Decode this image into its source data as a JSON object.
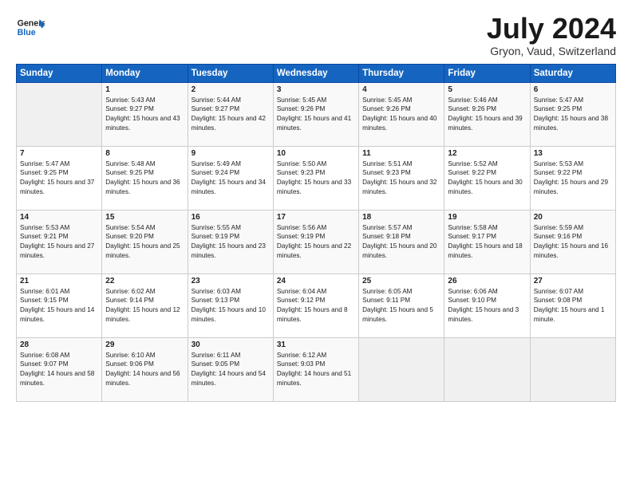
{
  "header": {
    "logo_line1": "General",
    "logo_line2": "Blue",
    "title": "July 2024",
    "subtitle": "Gryon, Vaud, Switzerland"
  },
  "weekdays": [
    "Sunday",
    "Monday",
    "Tuesday",
    "Wednesday",
    "Thursday",
    "Friday",
    "Saturday"
  ],
  "weeks": [
    [
      {
        "day": "",
        "empty": true
      },
      {
        "day": "1",
        "sunrise": "Sunrise: 5:43 AM",
        "sunset": "Sunset: 9:27 PM",
        "daylight": "Daylight: 15 hours and 43 minutes."
      },
      {
        "day": "2",
        "sunrise": "Sunrise: 5:44 AM",
        "sunset": "Sunset: 9:27 PM",
        "daylight": "Daylight: 15 hours and 42 minutes."
      },
      {
        "day": "3",
        "sunrise": "Sunrise: 5:45 AM",
        "sunset": "Sunset: 9:26 PM",
        "daylight": "Daylight: 15 hours and 41 minutes."
      },
      {
        "day": "4",
        "sunrise": "Sunrise: 5:45 AM",
        "sunset": "Sunset: 9:26 PM",
        "daylight": "Daylight: 15 hours and 40 minutes."
      },
      {
        "day": "5",
        "sunrise": "Sunrise: 5:46 AM",
        "sunset": "Sunset: 9:26 PM",
        "daylight": "Daylight: 15 hours and 39 minutes."
      },
      {
        "day": "6",
        "sunrise": "Sunrise: 5:47 AM",
        "sunset": "Sunset: 9:25 PM",
        "daylight": "Daylight: 15 hours and 38 minutes."
      }
    ],
    [
      {
        "day": "7",
        "sunrise": "Sunrise: 5:47 AM",
        "sunset": "Sunset: 9:25 PM",
        "daylight": "Daylight: 15 hours and 37 minutes."
      },
      {
        "day": "8",
        "sunrise": "Sunrise: 5:48 AM",
        "sunset": "Sunset: 9:25 PM",
        "daylight": "Daylight: 15 hours and 36 minutes."
      },
      {
        "day": "9",
        "sunrise": "Sunrise: 5:49 AM",
        "sunset": "Sunset: 9:24 PM",
        "daylight": "Daylight: 15 hours and 34 minutes."
      },
      {
        "day": "10",
        "sunrise": "Sunrise: 5:50 AM",
        "sunset": "Sunset: 9:23 PM",
        "daylight": "Daylight: 15 hours and 33 minutes."
      },
      {
        "day": "11",
        "sunrise": "Sunrise: 5:51 AM",
        "sunset": "Sunset: 9:23 PM",
        "daylight": "Daylight: 15 hours and 32 minutes."
      },
      {
        "day": "12",
        "sunrise": "Sunrise: 5:52 AM",
        "sunset": "Sunset: 9:22 PM",
        "daylight": "Daylight: 15 hours and 30 minutes."
      },
      {
        "day": "13",
        "sunrise": "Sunrise: 5:53 AM",
        "sunset": "Sunset: 9:22 PM",
        "daylight": "Daylight: 15 hours and 29 minutes."
      }
    ],
    [
      {
        "day": "14",
        "sunrise": "Sunrise: 5:53 AM",
        "sunset": "Sunset: 9:21 PM",
        "daylight": "Daylight: 15 hours and 27 minutes."
      },
      {
        "day": "15",
        "sunrise": "Sunrise: 5:54 AM",
        "sunset": "Sunset: 9:20 PM",
        "daylight": "Daylight: 15 hours and 25 minutes."
      },
      {
        "day": "16",
        "sunrise": "Sunrise: 5:55 AM",
        "sunset": "Sunset: 9:19 PM",
        "daylight": "Daylight: 15 hours and 23 minutes."
      },
      {
        "day": "17",
        "sunrise": "Sunrise: 5:56 AM",
        "sunset": "Sunset: 9:19 PM",
        "daylight": "Daylight: 15 hours and 22 minutes."
      },
      {
        "day": "18",
        "sunrise": "Sunrise: 5:57 AM",
        "sunset": "Sunset: 9:18 PM",
        "daylight": "Daylight: 15 hours and 20 minutes."
      },
      {
        "day": "19",
        "sunrise": "Sunrise: 5:58 AM",
        "sunset": "Sunset: 9:17 PM",
        "daylight": "Daylight: 15 hours and 18 minutes."
      },
      {
        "day": "20",
        "sunrise": "Sunrise: 5:59 AM",
        "sunset": "Sunset: 9:16 PM",
        "daylight": "Daylight: 15 hours and 16 minutes."
      }
    ],
    [
      {
        "day": "21",
        "sunrise": "Sunrise: 6:01 AM",
        "sunset": "Sunset: 9:15 PM",
        "daylight": "Daylight: 15 hours and 14 minutes."
      },
      {
        "day": "22",
        "sunrise": "Sunrise: 6:02 AM",
        "sunset": "Sunset: 9:14 PM",
        "daylight": "Daylight: 15 hours and 12 minutes."
      },
      {
        "day": "23",
        "sunrise": "Sunrise: 6:03 AM",
        "sunset": "Sunset: 9:13 PM",
        "daylight": "Daylight: 15 hours and 10 minutes."
      },
      {
        "day": "24",
        "sunrise": "Sunrise: 6:04 AM",
        "sunset": "Sunset: 9:12 PM",
        "daylight": "Daylight: 15 hours and 8 minutes."
      },
      {
        "day": "25",
        "sunrise": "Sunrise: 6:05 AM",
        "sunset": "Sunset: 9:11 PM",
        "daylight": "Daylight: 15 hours and 5 minutes."
      },
      {
        "day": "26",
        "sunrise": "Sunrise: 6:06 AM",
        "sunset": "Sunset: 9:10 PM",
        "daylight": "Daylight: 15 hours and 3 minutes."
      },
      {
        "day": "27",
        "sunrise": "Sunrise: 6:07 AM",
        "sunset": "Sunset: 9:08 PM",
        "daylight": "Daylight: 15 hours and 1 minute."
      }
    ],
    [
      {
        "day": "28",
        "sunrise": "Sunrise: 6:08 AM",
        "sunset": "Sunset: 9:07 PM",
        "daylight": "Daylight: 14 hours and 58 minutes."
      },
      {
        "day": "29",
        "sunrise": "Sunrise: 6:10 AM",
        "sunset": "Sunset: 9:06 PM",
        "daylight": "Daylight: 14 hours and 56 minutes."
      },
      {
        "day": "30",
        "sunrise": "Sunrise: 6:11 AM",
        "sunset": "Sunset: 9:05 PM",
        "daylight": "Daylight: 14 hours and 54 minutes."
      },
      {
        "day": "31",
        "sunrise": "Sunrise: 6:12 AM",
        "sunset": "Sunset: 9:03 PM",
        "daylight": "Daylight: 14 hours and 51 minutes."
      },
      {
        "day": "",
        "empty": true
      },
      {
        "day": "",
        "empty": true
      },
      {
        "day": "",
        "empty": true
      }
    ]
  ]
}
